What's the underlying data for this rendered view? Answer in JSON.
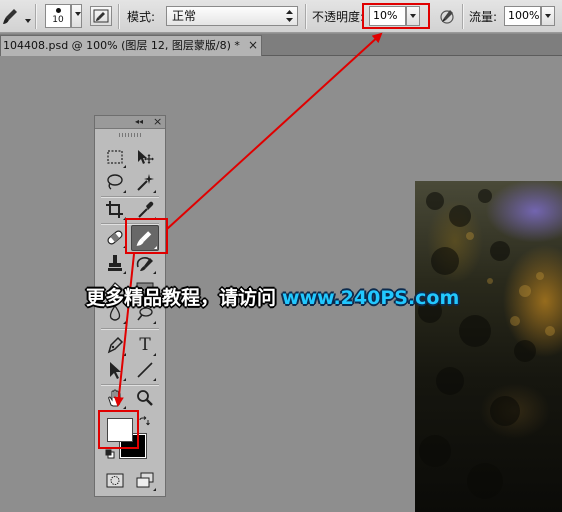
{
  "options_bar": {
    "brush_size": "10",
    "mode_label": "模式:",
    "mode_value": "正常",
    "opacity_label": "不透明度:",
    "opacity_value": "10%",
    "flow_label": "流量:",
    "flow_value": "100%"
  },
  "document_tab": {
    "title": "104408.psd @ 100% (图层 12, 图层蒙版/8) *",
    "close": "×"
  },
  "tools_panel": {
    "collapse_glyph": "◂◂",
    "close_glyph": "×",
    "tools": [
      {
        "name": "rectangular-marquee-icon"
      },
      {
        "name": "move-icon"
      },
      {
        "name": "lasso-icon"
      },
      {
        "name": "magic-wand-icon"
      },
      {
        "name": "crop-icon"
      },
      {
        "name": "eyedropper-icon"
      },
      {
        "name": "healing-brush-icon"
      },
      {
        "name": "brush-icon",
        "selected": true
      },
      {
        "name": "clone-stamp-icon"
      },
      {
        "name": "history-brush-icon"
      },
      {
        "name": "pen-icon"
      },
      {
        "name": "type-icon",
        "glyph": "T"
      },
      {
        "name": "path-selection-icon"
      },
      {
        "name": "line-icon"
      },
      {
        "name": "hand-icon"
      },
      {
        "name": "zoom-icon"
      }
    ],
    "foreground_color": "#ffffff",
    "background_color": "#000000"
  },
  "watermark": {
    "text_cn": "更多精品教程，请访问",
    "text_url": "www.240PS.com"
  },
  "colors": {
    "highlight": "#e00000",
    "canvas_bg": "#8e8e8e",
    "panel_bg": "#bcbcbc",
    "watermark_url": "#22c8ff"
  }
}
